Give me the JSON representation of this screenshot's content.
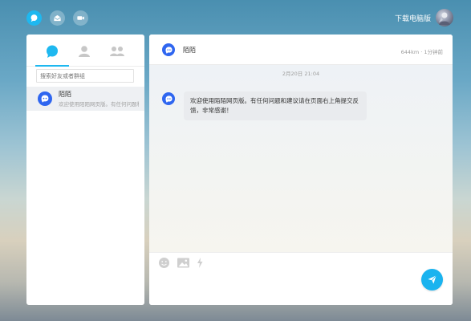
{
  "topbar": {
    "download_label": "下载电脑版",
    "icons": [
      "chat-bubble-icon",
      "mail-icon",
      "video-camera-icon"
    ]
  },
  "left": {
    "tabs": [
      "conversations",
      "contacts",
      "groups"
    ],
    "search": {
      "placeholder": "搜索好友或者群组",
      "value": ""
    },
    "conversations": [
      {
        "name": "陌陌",
        "preview": "欢迎使用陌陌网页版。有任何问题和建议请在页面右上角提交反馈，非常感谢！"
      }
    ]
  },
  "chat": {
    "name": "陌陌",
    "meta": "644km · 1分钟前",
    "timestamp": "2月20日 21:04",
    "messages": [
      {
        "from": "陌陌",
        "text": "欢迎使用陌陌网页版。有任何问题和建议请在页面右上角提交反馈，非常感谢！"
      }
    ]
  },
  "input": {
    "tools": [
      "emoji-icon",
      "image-icon",
      "lightning-icon"
    ],
    "send_icon": "send-icon"
  },
  "colors": {
    "accent": "#1eb8f0",
    "brand": "#2f66f0"
  }
}
